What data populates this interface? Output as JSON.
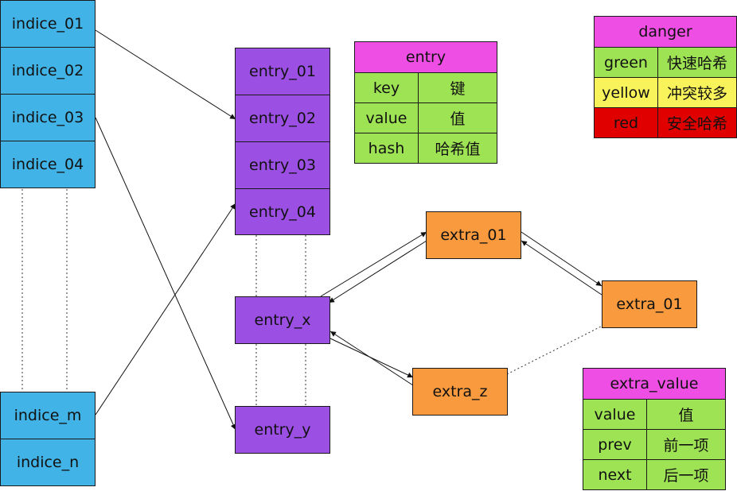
{
  "indices": {
    "top": [
      "indice_01",
      "indice_02",
      "indice_03",
      "indice_04"
    ],
    "bottom": [
      "indice_m",
      "indice_n"
    ]
  },
  "entries": {
    "top": [
      "entry_01",
      "entry_02",
      "entry_03",
      "entry_04"
    ],
    "x": "entry_x",
    "y": "entry_y"
  },
  "extras": {
    "a": "extra_01",
    "b": "extra_01",
    "z": "extra_z"
  },
  "entry_table": {
    "title": "entry",
    "rows": [
      {
        "k": "key",
        "v": "键"
      },
      {
        "k": "value",
        "v": "值"
      },
      {
        "k": "hash",
        "v": "哈希值"
      }
    ]
  },
  "danger_table": {
    "title": "danger",
    "rows": [
      {
        "k": "green",
        "v": "快速哈希",
        "color": "#9ee353"
      },
      {
        "k": "yellow",
        "v": "冲突较多",
        "color": "#f8f25b"
      },
      {
        "k": "red",
        "v": "安全哈希",
        "color": "#e00000"
      }
    ]
  },
  "extra_value_table": {
    "title": "extra_value",
    "rows": [
      {
        "k": "value",
        "v": "值"
      },
      {
        "k": "prev",
        "v": "前一项"
      },
      {
        "k": "next",
        "v": "后一项"
      }
    ]
  },
  "colors": {
    "indice": "#41b3e6",
    "entry": "#9b4fe3",
    "extra": "#f89a3d",
    "header": "#ee4ee3",
    "cell": "#9ee353"
  }
}
